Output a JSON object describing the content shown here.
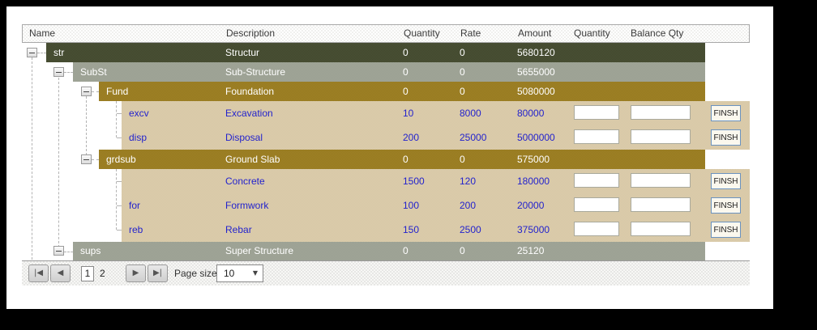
{
  "header": {
    "columns": {
      "name": "Name",
      "description": "Description",
      "quantity": "Quantity",
      "rate": "Rate",
      "amount": "Amount",
      "quantity2": "Quantity",
      "balance_qty": "Balance Qty"
    }
  },
  "rows": [
    {
      "name": "str",
      "description": "Structur",
      "quantity": "0",
      "rate": "0",
      "amount": "5680120"
    },
    {
      "name": "SubSt",
      "description": "Sub-Structure",
      "quantity": "0",
      "rate": "0",
      "amount": "5655000"
    },
    {
      "name": "Fund",
      "description": "Foundation",
      "quantity": "0",
      "rate": "0",
      "amount": "5080000"
    },
    {
      "name": "excv",
      "description": "Excavation",
      "quantity": "10",
      "rate": "8000",
      "amount": "80000"
    },
    {
      "name": "disp",
      "description": "Disposal",
      "quantity": "200",
      "rate": "25000",
      "amount": "5000000"
    },
    {
      "name": "grdsub",
      "description": "Ground Slab",
      "quantity": "0",
      "rate": "0",
      "amount": "575000"
    },
    {
      "name": "",
      "description": "Concrete",
      "quantity": "1500",
      "rate": "120",
      "amount": "180000"
    },
    {
      "name": "for",
      "description": "Formwork",
      "quantity": "100",
      "rate": "200",
      "amount": "20000"
    },
    {
      "name": "reb",
      "description": "Rebar",
      "quantity": "150",
      "rate": "2500",
      "amount": "375000"
    },
    {
      "name": "sups",
      "description": "Super Structure",
      "quantity": "0",
      "rate": "0",
      "amount": "25120"
    }
  ],
  "buttons": {
    "finish_label": "FINSH"
  },
  "inputs": {
    "quantity_value": "",
    "balance_value": ""
  },
  "pager": {
    "first": "|◀",
    "prev": "◀",
    "next": "▶",
    "last": "▶|",
    "pages": [
      "1",
      "2"
    ],
    "current_page": "1",
    "page_size_label": "Page size:",
    "page_size_value": "10",
    "dropdown_arrow": "▼"
  },
  "colors": {
    "row_level0": "#41482c",
    "row_level1": "#9ba092",
    "row_level2": "#987a1d",
    "row_leaf": "#dbceac",
    "leaf_text": "#2323cd",
    "finish_border": "#6b93c0"
  }
}
